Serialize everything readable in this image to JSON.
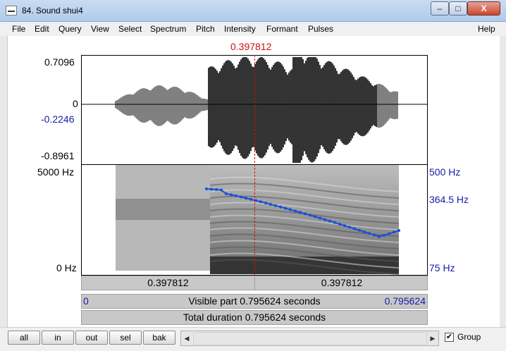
{
  "window": {
    "title": "84. Sound shui4",
    "min_label": "–",
    "max_label": "□",
    "close_label": "X"
  },
  "menu": {
    "items": [
      "File",
      "Edit",
      "Query",
      "View",
      "Select",
      "Spectrum",
      "Pitch",
      "Intensity",
      "Formant",
      "Pulses"
    ],
    "help": "Help"
  },
  "cursor": {
    "time": "0.397812"
  },
  "waveform": {
    "max": "0.7096",
    "zero": "0",
    "cursor_value": "-0.2246",
    "min": "-0.8961"
  },
  "spectrogram": {
    "top_freq": "5000 Hz",
    "bottom_freq": "0 Hz"
  },
  "pitch": {
    "top": "500 Hz",
    "current": "364.5 Hz",
    "bottom": "75 Hz"
  },
  "rows": {
    "left_time": "0.397812",
    "right_time": "0.397812",
    "visible_start": "0",
    "visible_text": "Visible part 0.795624 seconds",
    "visible_end": "0.795624",
    "total_text": "Total duration 0.795624 seconds"
  },
  "bottom": {
    "buttons": [
      "all",
      "in",
      "out",
      "sel",
      "bak"
    ],
    "scroll_left": "◀",
    "scroll_right": "▶",
    "group_check": "✔",
    "group_label": "Group"
  }
}
